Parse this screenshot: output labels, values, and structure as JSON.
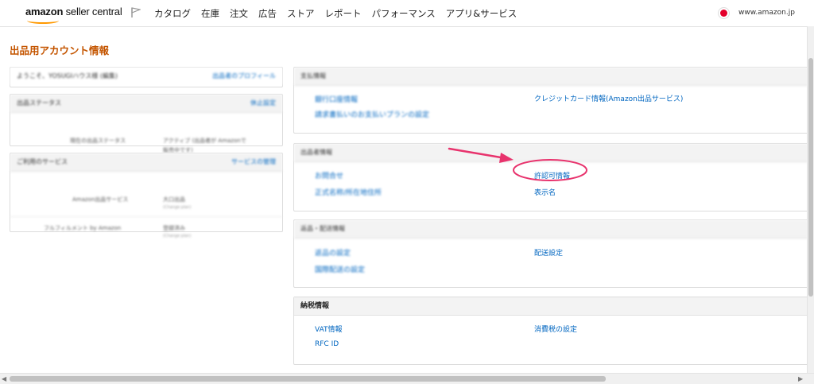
{
  "header": {
    "logo_bold": "amazon",
    "logo_rest": " seller central",
    "nav": [
      "カタログ",
      "在庫",
      "注文",
      "広告",
      "ストア",
      "レポート",
      "パフォーマンス",
      "アプリ&サービス"
    ],
    "domain": "www.amazon.jp"
  },
  "page_title": "出品用アカウント情報",
  "left": {
    "welcome": "ようこそ、YOSUGIハウス様 (編集)",
    "welcome_link": "出品者のプロフィール",
    "status_head": "出品ステータス",
    "status_head_link": "休止設定",
    "status_label": "現在の出品ステータス",
    "status_value_1": "アクティブ (出品者が Amazonで",
    "status_value_2": "販売中です)",
    "services_head": "ご利用のサービス",
    "services_head_link": "サービスの管理",
    "service1_label": "Amazon出品サービス",
    "service1_value": "大口出品",
    "service1_sub": "(Change plan)",
    "service2_label": "フルフィルメント by Amazon",
    "service2_value": "登録済み",
    "service2_sub": "(Change plan)"
  },
  "right": {
    "payment_head": "支払情報",
    "payment_link1": "銀行口座情報",
    "payment_link2": "請求書払いのお支払いプランの設定",
    "payment_link3": "クレジットカード情報(Amazon出品サービス)",
    "seller_head": "出品者情報",
    "seller_link1": "お問合せ",
    "seller_link2": "正式名称/所在地住所",
    "seller_link3": "許認可情報",
    "seller_link4": "表示名",
    "shipping_head": "返品・配送情報",
    "shipping_link1": "返品の設定",
    "shipping_link2": "国際配送の設定",
    "shipping_link3": "配送設定",
    "tax_head": "納税情報",
    "tax_link1": "VAT情報",
    "tax_link2": "RFC ID",
    "tax_link3": "消費税の設定"
  },
  "colors": {
    "link": "#0066c0",
    "title": "#c45500",
    "annotation": "#e8336d"
  }
}
